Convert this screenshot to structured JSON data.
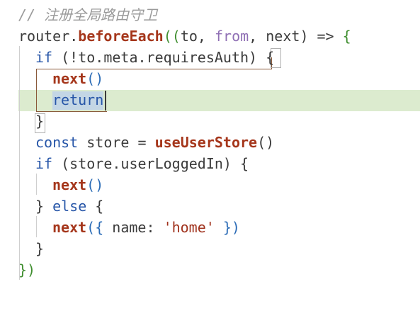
{
  "editor": {
    "lines": [
      {
        "id": "l1",
        "text": "// 注册全局路由守卫"
      },
      {
        "id": "l2",
        "tokens": [
          "router",
          ".",
          "beforeEach",
          "((",
          "to",
          ", ",
          "from",
          ", ",
          "next",
          ") => ",
          "{"
        ]
      },
      {
        "id": "l3",
        "tokens": [
          "if",
          " (!to.meta.requiresAuth) ",
          "{"
        ]
      },
      {
        "id": "l4",
        "tokens": [
          "next",
          "()"
        ]
      },
      {
        "id": "l5",
        "tokens": [
          "return"
        ]
      },
      {
        "id": "l6",
        "tokens": [
          "}"
        ]
      },
      {
        "id": "l7",
        "tokens": [
          "const",
          " store = ",
          "useUserStore",
          "()"
        ]
      },
      {
        "id": "l8",
        "tokens": [
          "if",
          " (store.userLoggedIn) ",
          "{"
        ]
      },
      {
        "id": "l9",
        "tokens": [
          "next",
          "()"
        ]
      },
      {
        "id": "l10",
        "tokens": [
          "}",
          " else ",
          "{"
        ]
      },
      {
        "id": "l11",
        "tokens": [
          "next",
          "({ ",
          "name",
          ": ",
          "'home'",
          " })"
        ]
      },
      {
        "id": "l12",
        "tokens": [
          "}"
        ]
      },
      {
        "id": "l13",
        "tokens": [
          "})"
        ]
      }
    ]
  },
  "colors": {
    "keyword": "#2756a8",
    "function": "#a5361b",
    "string": "#a0321d",
    "comment": "#9a9a9a",
    "current_line": "#dcebcf",
    "selection": "#c3d6e5"
  }
}
